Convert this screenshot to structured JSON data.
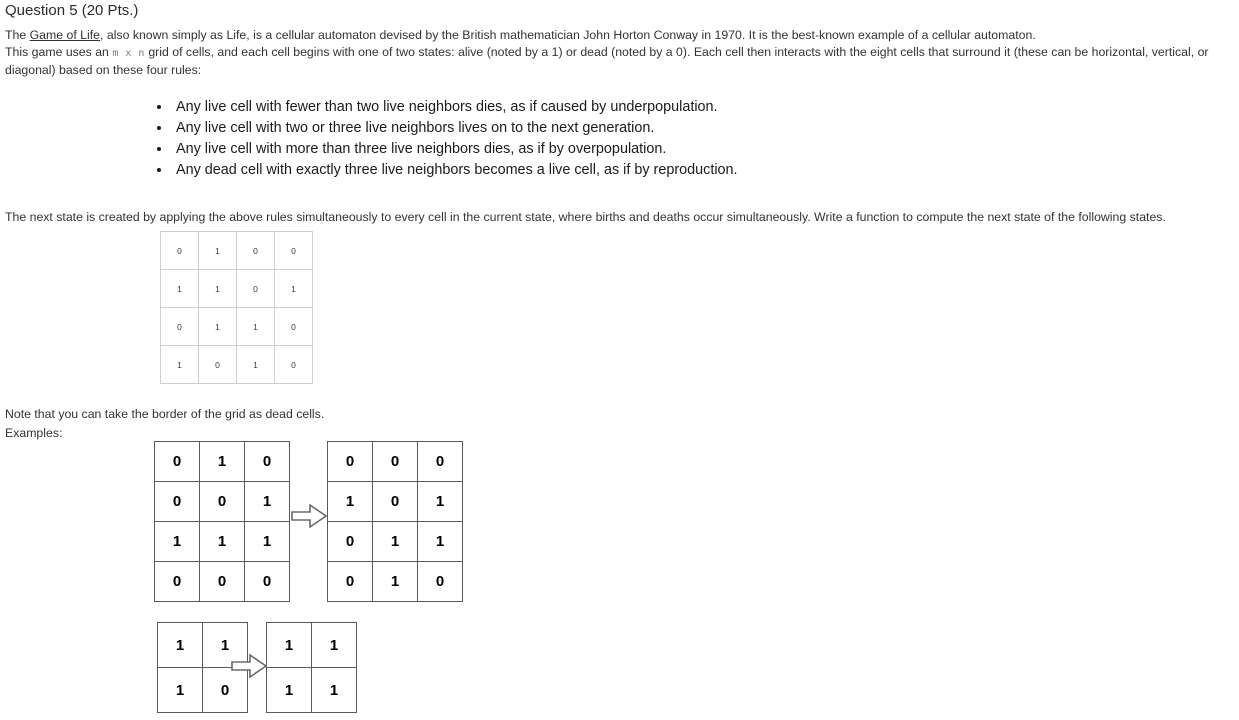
{
  "title": "Question 5 (20 Pts.)",
  "intro": {
    "line1_before_link": "The ",
    "link_text": "Game of Life",
    "line1_after_link": ", also known simply as Life, is a cellular automaton devised by the British mathematician John Horton Conway in 1970. It is the best-known example of a cellular automaton.",
    "line2_before_code": "This game uses an ",
    "code_text": "m x n",
    "line2_after_code": " grid of cells, and each cell begins with one of two states: alive (noted by a 1) or dead (noted by a 0). Each cell then interacts with the eight cells that surround it (these can be horizontal, vertical, or diagonal) based on these four rules:"
  },
  "rules": [
    "Any live cell with fewer than two live neighbors dies, as if caused by underpopulation.",
    "Any live cell with two or three live neighbors lives on to the next generation.",
    "Any live cell with more than three live neighbors dies, as if by overpopulation.",
    "Any dead cell with exactly three live neighbors becomes a live cell, as if by reproduction."
  ],
  "next_state_text": "The next state is created by applying the above rules simultaneously to every cell in the current state, where births and deaths occur simultaneously. Write a function to compute the next state of the following states.",
  "state_grid": {
    "rows": [
      [
        "0",
        "1",
        "0",
        "0"
      ],
      [
        "1",
        "1",
        "0",
        "1"
      ],
      [
        "0",
        "1",
        "1",
        "0"
      ],
      [
        "1",
        "0",
        "1",
        "0"
      ]
    ]
  },
  "note_text": "Note that you can take the border of the grid as dead cells.",
  "examples_label": "Examples:",
  "examples": [
    {
      "arrow": "⇒",
      "input_rows": [
        [
          "0",
          "1",
          "0"
        ],
        [
          "0",
          "0",
          "1"
        ],
        [
          "1",
          "1",
          "1"
        ],
        [
          "0",
          "0",
          "0"
        ]
      ],
      "output_rows": [
        [
          "0",
          "0",
          "0"
        ],
        [
          "1",
          "0",
          "1"
        ],
        [
          "0",
          "1",
          "1"
        ],
        [
          "0",
          "1",
          "0"
        ]
      ]
    },
    {
      "arrow": "⇒",
      "input_rows": [
        [
          "1",
          "1"
        ],
        [
          "1",
          "0"
        ]
      ],
      "output_rows": [
        [
          "1",
          "1"
        ],
        [
          "1",
          "1"
        ]
      ]
    }
  ],
  "colors": {
    "page_background": "#ffffff",
    "body_text": "#333333",
    "light_grid_border": "#cfcfcf",
    "bold_grid_border": "#5a5a5a",
    "code_text": "#7a7f87"
  }
}
